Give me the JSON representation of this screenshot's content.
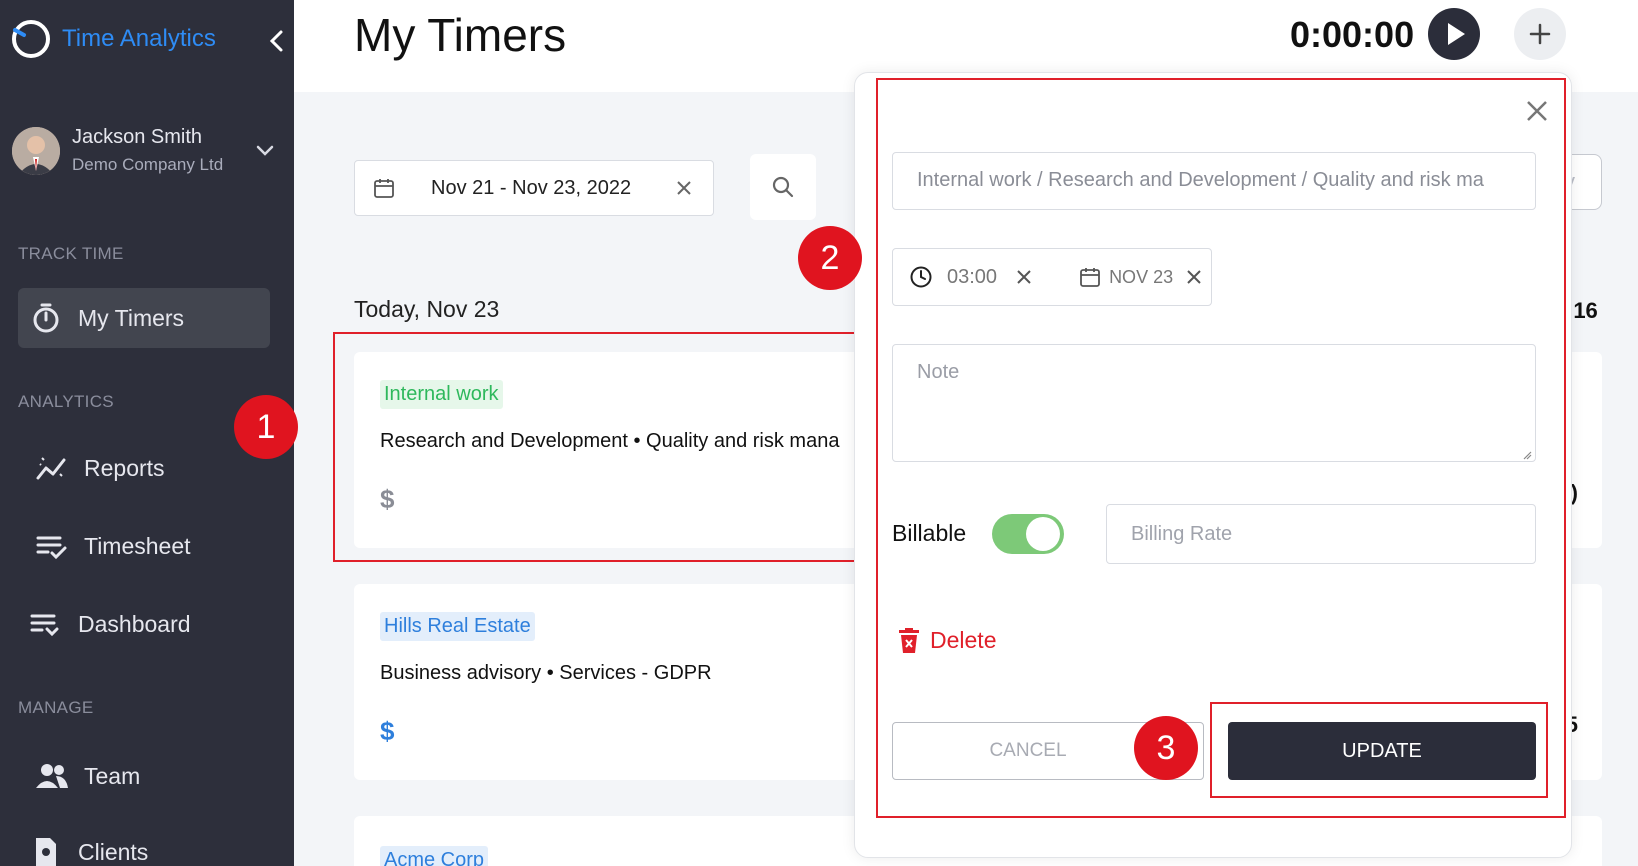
{
  "sidebar": {
    "brand": "Time Analytics",
    "user": {
      "name": "Jackson Smith",
      "company": "Demo Company Ltd"
    },
    "sections": {
      "track": "TRACK TIME",
      "analytics": "ANALYTICS",
      "manage": "MANAGE"
    },
    "items": {
      "my_timers": "My Timers",
      "reports": "Reports",
      "timesheet": "Timesheet",
      "dashboard": "Dashboard",
      "team": "Team",
      "clients": "Clients"
    }
  },
  "header": {
    "title": "My Timers",
    "timer": "0:00:00"
  },
  "filters": {
    "date_range": "Nov 21 - Nov 23, 2022",
    "peek_button_fragment": "y"
  },
  "day": {
    "label": "Today, Nov 23",
    "total_fragment": ":16"
  },
  "entries": [
    {
      "client": "Internal work",
      "description": "Research and Development • Quality and risk mana",
      "currency": "$",
      "value_fragment": ")",
      "tag_color": "#2eb85c",
      "tag_bg": "#e6f7ea",
      "dollar_color": "#8a8d96"
    },
    {
      "client": "Hills Real Estate",
      "description": "Business advisory • Services - GDPR",
      "currency": "$",
      "value_fragment": "5",
      "tag_color": "#2e7fdc",
      "tag_bg": "#e3eefb",
      "dollar_color": "#2e7fdc"
    },
    {
      "client": "Acme Corp",
      "tag_color": "#2e7fdc",
      "tag_bg": "#e3eefb"
    }
  ],
  "modal": {
    "project": "Internal work / Research and Development / Quality and risk ma",
    "duration": "03:00",
    "date": "NOV 23",
    "note_placeholder": "Note",
    "billable_label": "Billable",
    "billable": true,
    "billing_rate_placeholder": "Billing Rate",
    "delete_label": "Delete",
    "cancel_label": "CANCEL",
    "update_label": "UPDATE"
  },
  "callouts": [
    "1",
    "2",
    "3"
  ],
  "colors": {
    "sidebar_bg": "#2d2f3b",
    "accent": "#2e8cf5",
    "danger": "#e0202a",
    "toggle_on": "#7dc978",
    "primary_button": "#2b2d3a"
  }
}
